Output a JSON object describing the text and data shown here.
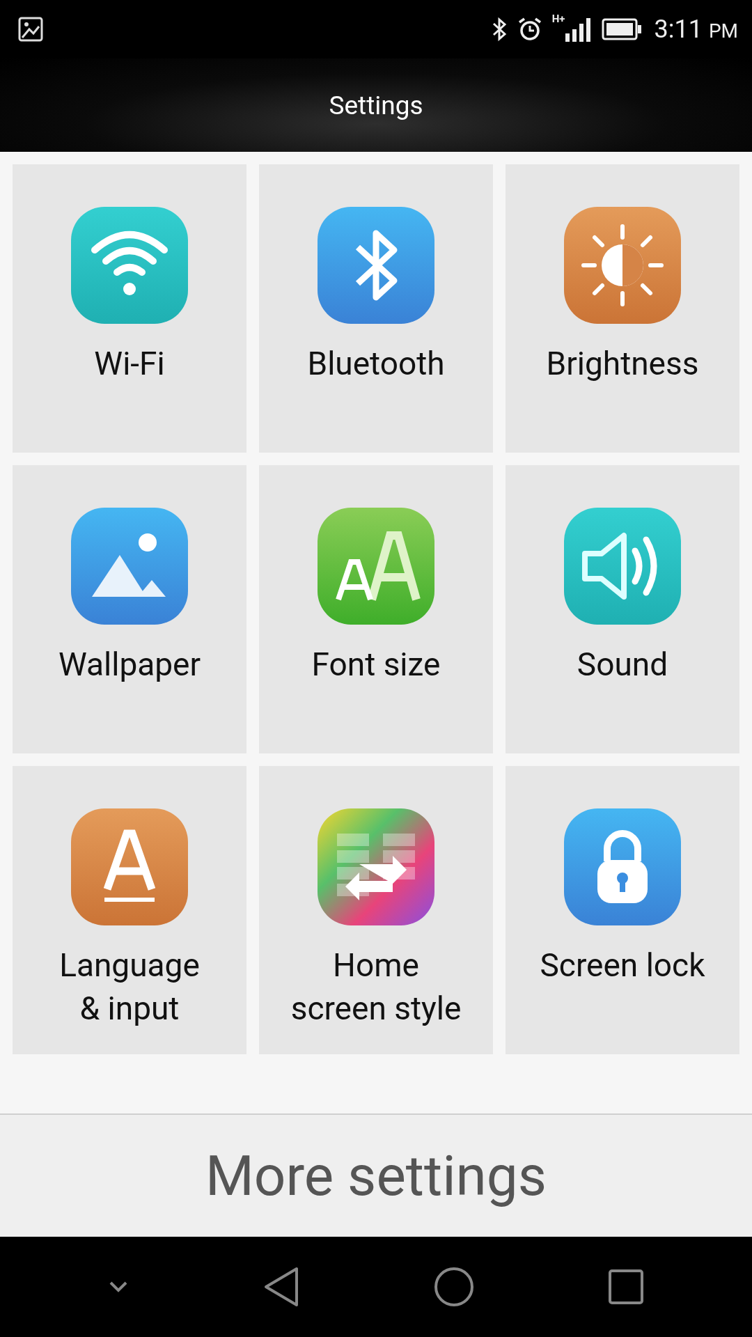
{
  "status_bar": {
    "network": "H+",
    "time": "3:11",
    "period": "PM"
  },
  "header": {
    "title": "Settings"
  },
  "tiles": [
    {
      "label": "Wi-Fi"
    },
    {
      "label": "Bluetooth"
    },
    {
      "label": "Brightness"
    },
    {
      "label": "Wallpaper"
    },
    {
      "label": "Font size"
    },
    {
      "label": "Sound"
    },
    {
      "label": "Language & input"
    },
    {
      "label": "Home screen style"
    },
    {
      "label": "Screen lock"
    }
  ],
  "more_button": {
    "label": "More settings"
  }
}
